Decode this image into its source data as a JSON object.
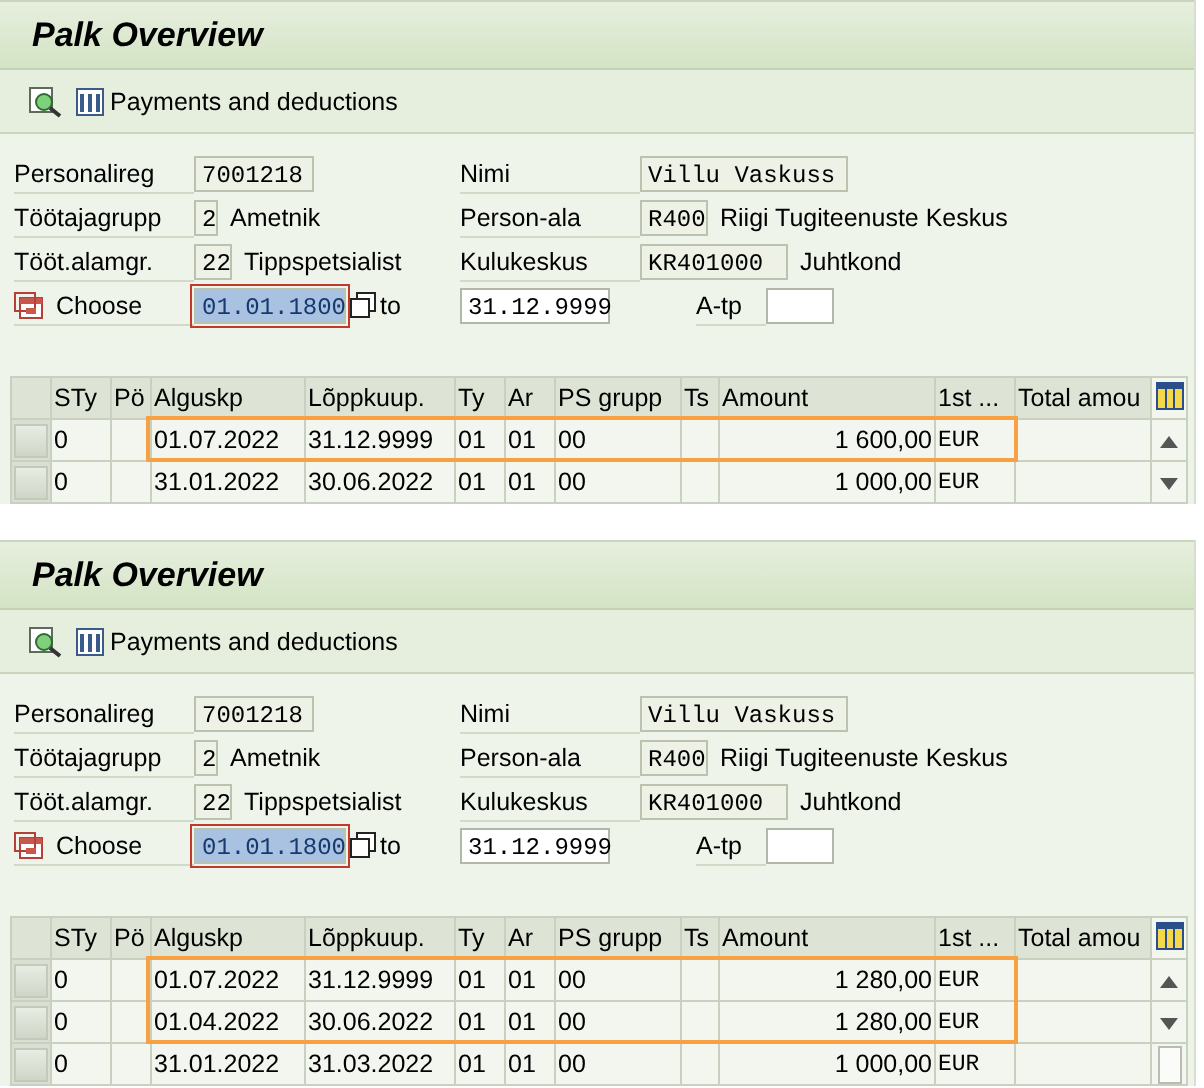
{
  "panels": [
    {
      "title": "Palk Overview",
      "toolbar": {
        "button": "Payments and deductions"
      },
      "form": {
        "personnel_number": {
          "label": "Personalireg",
          "value": "7001218"
        },
        "name": {
          "label": "Nimi",
          "value": "Villu Vaskuss"
        },
        "employee_group": {
          "label": "Töötajagrupp",
          "value": "2",
          "text": "Ametnik"
        },
        "personnel_area": {
          "label": "Person-ala",
          "value": "R400",
          "text": "Riigi Tugiteenuste Keskus"
        },
        "employee_subgroup": {
          "label": "Tööt.alamgr.",
          "value": "22",
          "text": "Tippspetsialist"
        },
        "cost_center": {
          "label": "Kulukeskus",
          "value": "KR401000",
          "text": "Juhtkond"
        },
        "period": {
          "label": "Choose",
          "from": "01.01.1800",
          "from_selected": true,
          "to_label": "to",
          "to": "31.12.9999"
        },
        "a_tp": {
          "label": "A-tp"
        }
      },
      "table": {
        "columns": [
          "STy",
          "Pö",
          "Alguskp",
          "Lõppkuup.",
          "Ty",
          "Ar",
          "PS grupp",
          "Ts",
          "Amount",
          "1st ...",
          "Total amou"
        ],
        "rows": [
          {
            "sty": "0",
            "start": "01.07.2022",
            "end": "31.12.9999",
            "ty": "01",
            "ar": "01",
            "ps_group": "00",
            "amount": "1 600,00",
            "currency": "EUR",
            "highlighted": true
          },
          {
            "sty": "0",
            "start": "31.01.2022",
            "end": "30.06.2022",
            "ty": "01",
            "ar": "01",
            "ps_group": "00",
            "amount": "1 000,00",
            "currency": "EUR",
            "highlighted": false
          }
        ]
      }
    },
    {
      "title": "Palk Overview",
      "toolbar": {
        "button": "Payments and deductions"
      },
      "form": {
        "personnel_number": {
          "label": "Personalireg",
          "value": "7001218"
        },
        "name": {
          "label": "Nimi",
          "value": "Villu Vaskuss"
        },
        "employee_group": {
          "label": "Töötajagrupp",
          "value": "2",
          "text": "Ametnik"
        },
        "personnel_area": {
          "label": "Person-ala",
          "value": "R400",
          "text": "Riigi Tugiteenuste Keskus"
        },
        "employee_subgroup": {
          "label": "Tööt.alamgr.",
          "value": "22",
          "text": "Tippspetsialist"
        },
        "cost_center": {
          "label": "Kulukeskus",
          "value": "KR401000",
          "text": "Juhtkond"
        },
        "period": {
          "label": "Choose",
          "from": "01.01.1800",
          "from_selected": true,
          "to_label": "to",
          "to": "31.12.9999"
        },
        "a_tp": {
          "label": "A-tp"
        }
      },
      "table": {
        "columns": [
          "STy",
          "Pö",
          "Alguskp",
          "Lõppkuup.",
          "Ty",
          "Ar",
          "PS grupp",
          "Ts",
          "Amount",
          "1st ...",
          "Total amou"
        ],
        "rows": [
          {
            "sty": "0",
            "start": "01.07.2022",
            "end": "31.12.9999",
            "ty": "01",
            "ar": "01",
            "ps_group": "00",
            "amount": "1 280,00",
            "currency": "EUR",
            "highlighted": true
          },
          {
            "sty": "0",
            "start": "01.04.2022",
            "end": "30.06.2022",
            "ty": "01",
            "ar": "01",
            "ps_group": "00",
            "amount": "1 280,00",
            "currency": "EUR",
            "highlighted": true
          },
          {
            "sty": "0",
            "start": "31.01.2022",
            "end": "31.03.2022",
            "ty": "01",
            "ar": "01",
            "ps_group": "00",
            "amount": "1 000,00",
            "currency": "EUR",
            "highlighted": false
          }
        ]
      }
    }
  ]
}
